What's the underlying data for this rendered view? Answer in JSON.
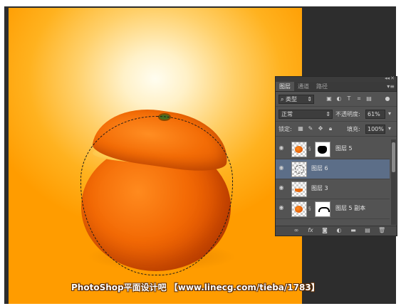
{
  "watermark": "PhotoShop平面设计吧  【www.linecg.com/tieba/1783】",
  "panel": {
    "tabs": [
      {
        "label": "图层",
        "active": true
      },
      {
        "label": "通道",
        "active": false
      },
      {
        "label": "路径",
        "active": false
      }
    ],
    "menu_icon": "panel-menu-icon",
    "filter": {
      "label": "类型",
      "icons": [
        "image-filter-icon",
        "adjustment-filter-icon",
        "type-filter-icon",
        "shape-filter-icon",
        "smart-object-filter-icon"
      ]
    },
    "blend_mode": "正常",
    "opacity_label": "不透明度:",
    "opacity_value": "61%",
    "lock_label": "锁定:",
    "fill_label": "填充:",
    "fill_value": "100%",
    "layers": [
      {
        "name": "图层 5",
        "visible": true,
        "has_mask": true,
        "selected": false
      },
      {
        "name": "图层 6",
        "visible": true,
        "has_mask": false,
        "selected": true
      },
      {
        "name": "图层 3",
        "visible": true,
        "has_mask": false,
        "selected": false
      },
      {
        "name": "图层 5 副本",
        "visible": true,
        "has_mask": true,
        "selected": false
      }
    ],
    "bottom_icons": [
      "link-layers-icon",
      "fx-icon",
      "add-mask-icon",
      "adjustment-layer-icon",
      "new-group-icon",
      "new-layer-icon",
      "delete-layer-icon"
    ],
    "fx_label": "fx",
    "colors": {
      "panel_bg": "#535353",
      "selected_row": "#5c6e88"
    }
  }
}
